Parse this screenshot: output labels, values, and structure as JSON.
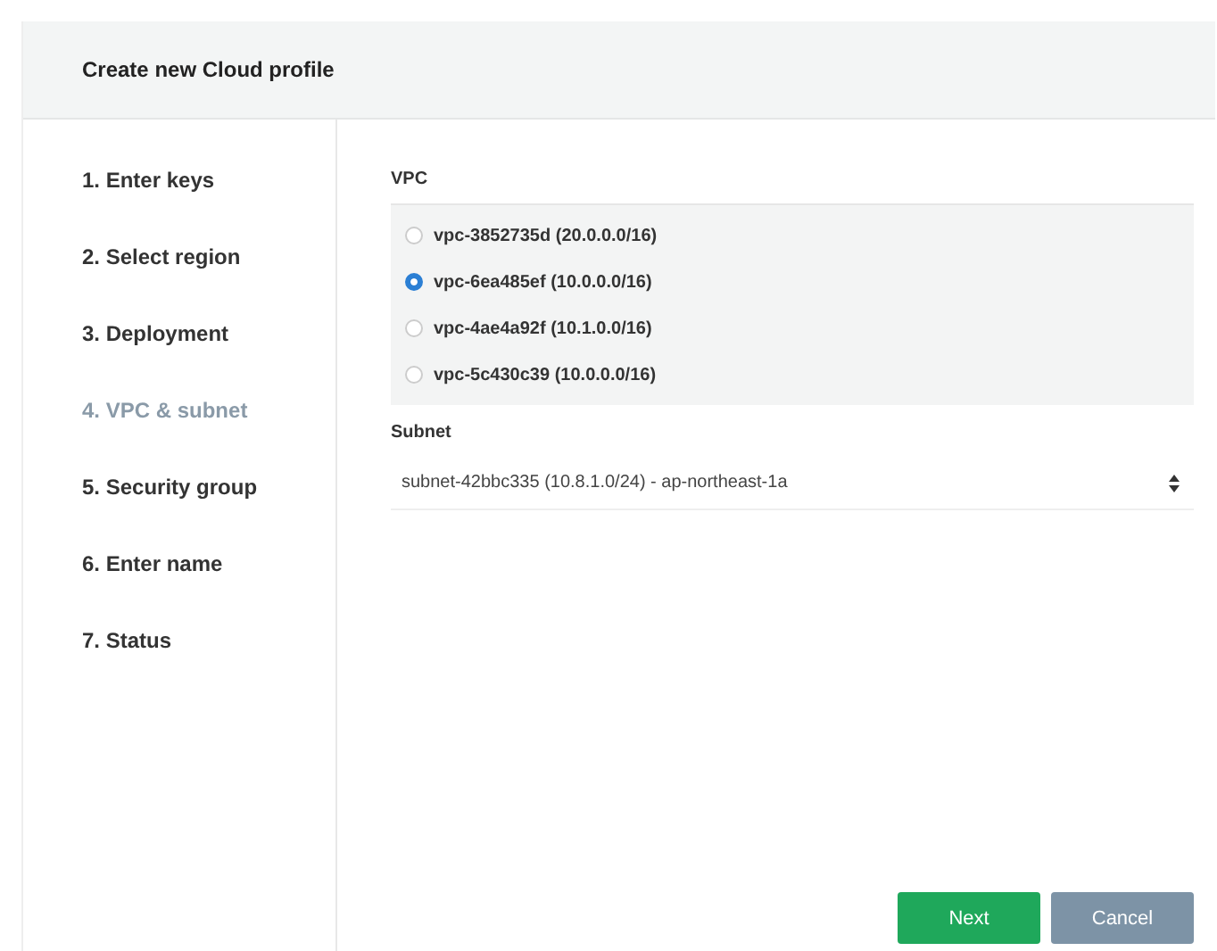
{
  "dialog": {
    "title": "Create new Cloud profile"
  },
  "steps": [
    {
      "label": "1. Enter keys",
      "selected": false
    },
    {
      "label": "2. Select region",
      "selected": false
    },
    {
      "label": "3. Deployment",
      "selected": false
    },
    {
      "label": "4. VPC & subnet",
      "selected": true
    },
    {
      "label": "5. Security group",
      "selected": false
    },
    {
      "label": "6. Enter name",
      "selected": false
    },
    {
      "label": "7. Status",
      "selected": false
    }
  ],
  "vpc": {
    "label": "VPC",
    "options": [
      {
        "label": "vpc-3852735d (20.0.0.0/16)",
        "selected": false
      },
      {
        "label": "vpc-6ea485ef (10.0.0.0/16)",
        "selected": true
      },
      {
        "label": "vpc-4ae4a92f (10.1.0.0/16)",
        "selected": false
      },
      {
        "label": "vpc-5c430c39 (10.0.0.0/16)",
        "selected": false
      }
    ]
  },
  "subnet": {
    "label": "Subnet",
    "value": "subnet-42bbc335 (10.8.1.0/24) - ap-northeast-1a"
  },
  "buttons": [
    {
      "label": "Next",
      "kind": "primary"
    },
    {
      "label": "Cancel",
      "kind": "secondary"
    }
  ]
}
